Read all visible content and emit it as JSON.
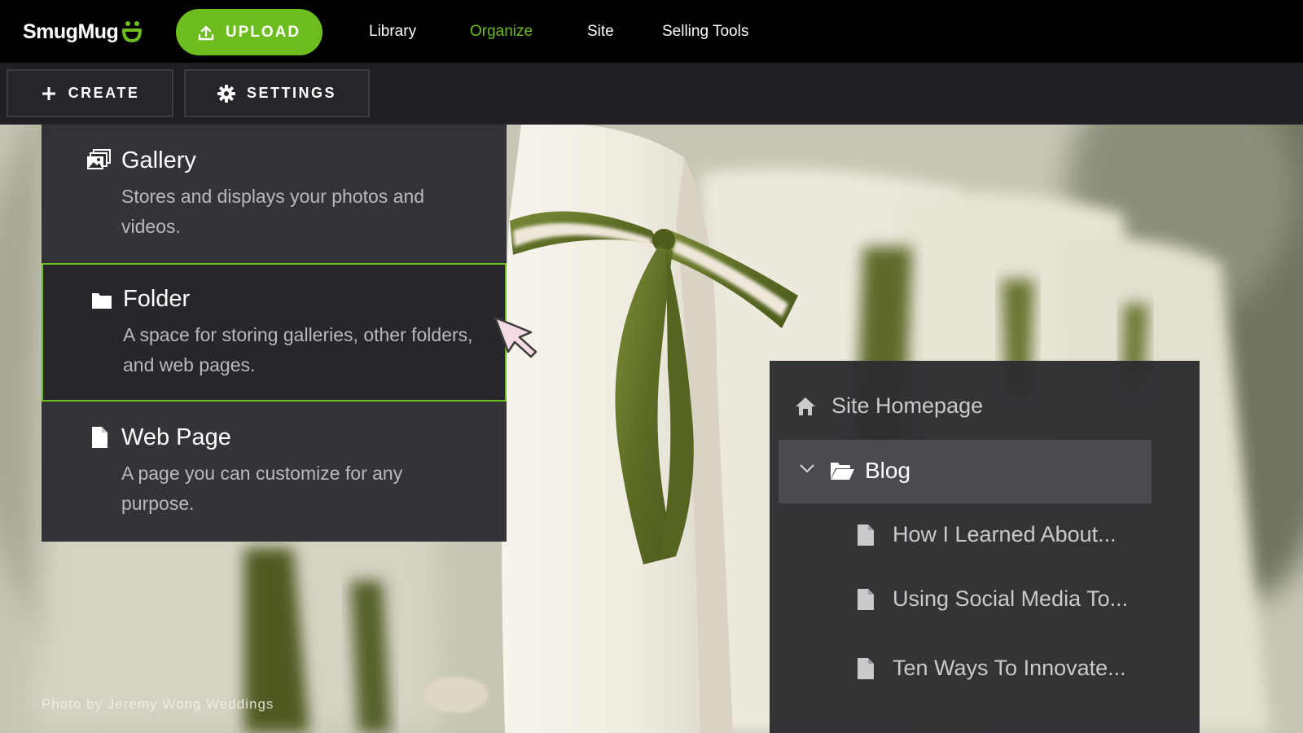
{
  "brand": {
    "name": "SmugMug",
    "accent": "#6dbd1f",
    "logo_icon": "smile-icon"
  },
  "topnav": {
    "upload_label": "UPLOAD",
    "upload_icon": "upload-icon",
    "links": [
      "Library",
      "Organize",
      "Site",
      "Selling Tools"
    ],
    "active": "Organize"
  },
  "toolbar": {
    "create_label": "CREATE",
    "create_icon": "plus-icon",
    "settings_label": "SETTINGS",
    "settings_icon": "gear-icon"
  },
  "create_menu": {
    "items": [
      {
        "icon": "gallery-icon",
        "title": "Gallery",
        "desc": "Stores and displays your photos and videos.",
        "highlighted": false
      },
      {
        "icon": "folder-icon",
        "title": "Folder",
        "desc": "A space for storing galleries, other folders, and web pages.",
        "highlighted": true
      },
      {
        "icon": "page-icon",
        "title": "Web Page",
        "desc": "A page you can customize for any purpose.",
        "highlighted": false
      }
    ]
  },
  "site_tree": {
    "homepage": {
      "icon": "home-icon",
      "label": "Site Homepage"
    },
    "folder": {
      "icon": "folder-open-icon",
      "expand_icon": "chevron-down-icon",
      "label": "Blog"
    },
    "pages": [
      {
        "icon": "page-icon",
        "label": "How I Learned About..."
      },
      {
        "icon": "page-icon",
        "label": "Using Social Media To..."
      },
      {
        "icon": "page-icon",
        "label": "Ten Ways To Innovate..."
      }
    ]
  },
  "photo": {
    "credit": "Photo by Jeremy Wong Weddings"
  }
}
